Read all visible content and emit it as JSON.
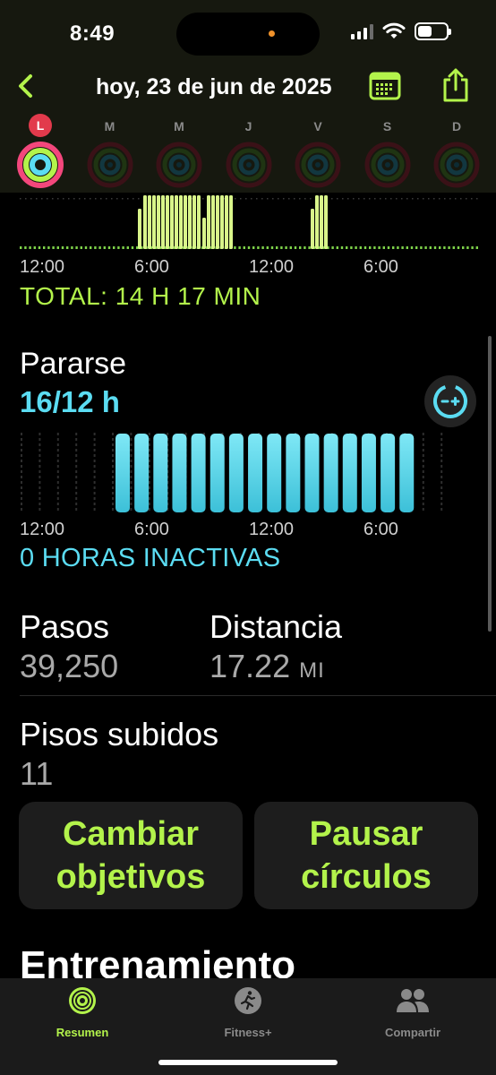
{
  "status_bar": {
    "time": "8:49"
  },
  "header": {
    "title": "hoy, 23 de jun de 2025",
    "back_icon": "chevron-left-icon",
    "calendar_icon": "calendar-icon",
    "share_icon": "share-icon"
  },
  "week": {
    "days": [
      {
        "label": "L",
        "today": true
      },
      {
        "label": "M",
        "today": false
      },
      {
        "label": "M",
        "today": false
      },
      {
        "label": "J",
        "today": false
      },
      {
        "label": "V",
        "today": false
      },
      {
        "label": "S",
        "today": false
      },
      {
        "label": "D",
        "today": false
      }
    ]
  },
  "exercise": {
    "axis": [
      "12:00",
      "6:00",
      "12:00",
      "6:00"
    ],
    "total": "TOTAL: 14 H 17 MIN"
  },
  "stand": {
    "title": "Pararse",
    "value": "16/12 h",
    "axis": [
      "12:00",
      "6:00",
      "12:00",
      "6:00"
    ],
    "inactive": "0 HORAS INACTIVAS",
    "adjust_icon": "adjust-goal-icon"
  },
  "steps": {
    "label": "Pasos",
    "value": "39,250"
  },
  "distance": {
    "label": "Distancia",
    "value": "17.22",
    "unit": "MI"
  },
  "floors": {
    "label": "Pisos subidos",
    "value": "11"
  },
  "actions": {
    "change_goals": "Cambiar objetivos",
    "pause_rings": "Pausar círculos"
  },
  "workouts": {
    "title": "Entrenamiento"
  },
  "tabbar": {
    "tabs": [
      {
        "label": "Resumen",
        "icon": "activity-rings-icon",
        "active": true
      },
      {
        "label": "Fitness+",
        "icon": "runner-icon",
        "active": false
      },
      {
        "label": "Compartir",
        "icon": "people-icon",
        "active": false
      }
    ]
  },
  "colors": {
    "accent_green": "#b3f34b",
    "accent_cyan": "#5bdcf2",
    "ring_red": "#e23a4c",
    "header_bg": "#16180f"
  }
}
